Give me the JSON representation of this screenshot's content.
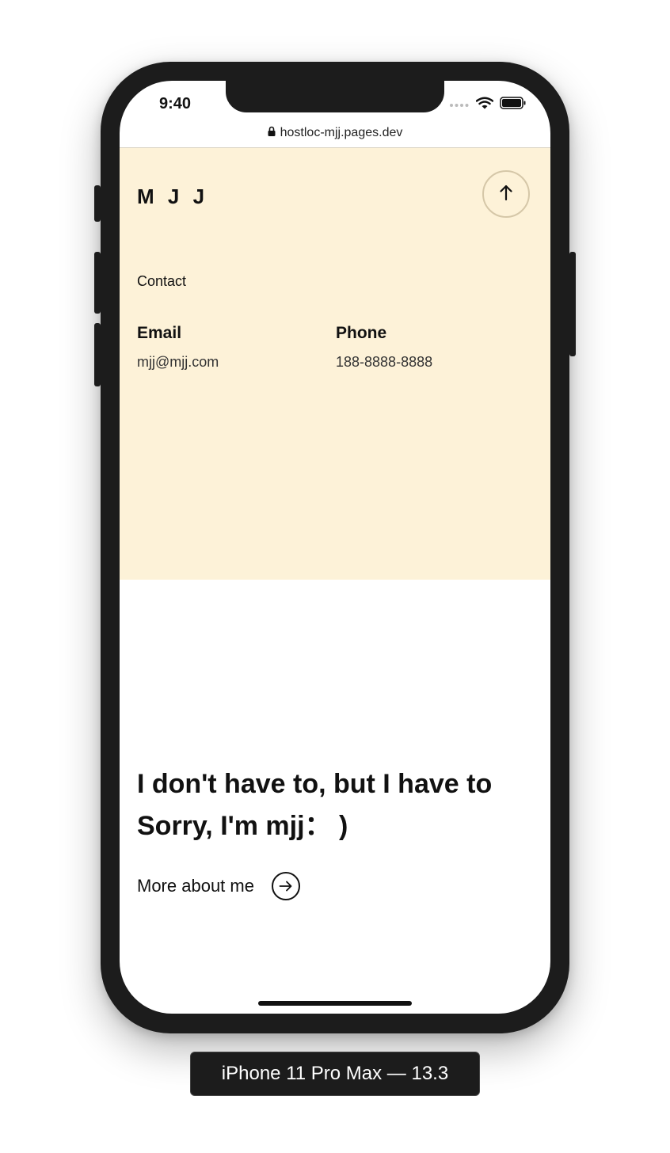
{
  "status_bar": {
    "time": "9:40"
  },
  "browser": {
    "url": "hostloc-mjj.pages.dev"
  },
  "header": {
    "logo": "M J J"
  },
  "contact": {
    "heading": "Contact",
    "email": {
      "label": "Email",
      "value": "mjj@mjj.com"
    },
    "phone": {
      "label": "Phone",
      "value": "188-8888-8888"
    }
  },
  "hero": {
    "line1": "I don't have to, but I have to",
    "line2": "Sorry, I'm mjj： )",
    "more_label": "More about me"
  },
  "device": {
    "label": "iPhone 11 Pro Max — 13.3"
  },
  "colors": {
    "cream": "#fdf2d8",
    "frame": "#1c1c1c"
  },
  "icons": {
    "back_to_top": "arrow-up-icon",
    "more": "arrow-right-circle-icon"
  }
}
